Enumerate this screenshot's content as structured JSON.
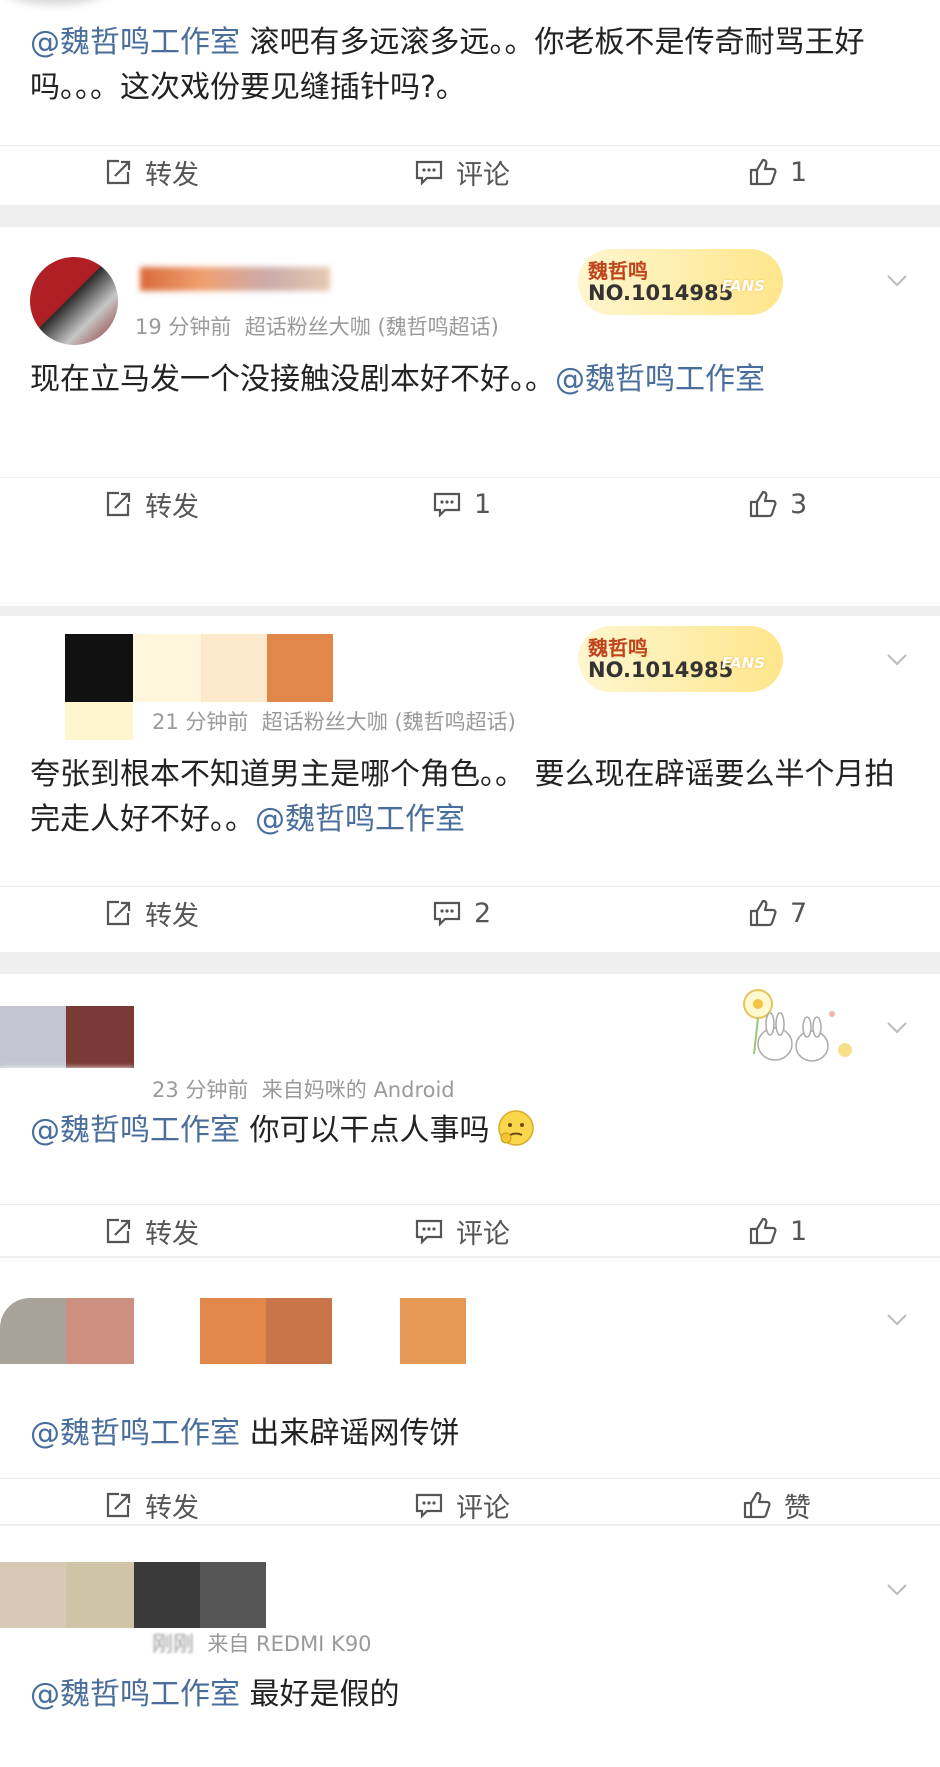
{
  "posts": [
    {
      "mention": "@魏哲鸣工作室",
      "text": " 滚吧有多远滚多远。。你老板不是传奇耐骂王好吗。。。这次戏份要见缝插针吗?。",
      "repost_label": "转发",
      "comment_label": "评论",
      "like_count": "1"
    },
    {
      "time": "19 分钟前",
      "source": "超话粉丝大咖 (魏哲鸣超话)",
      "badge_name": "魏哲鸣",
      "badge_no": "NO.1014985",
      "badge_fans": "FANS",
      "text": "现在立马发一个没接触没剧本好不好。。",
      "mention": "@魏哲鸣工作室",
      "repost_label": "转发",
      "comment_count": "1",
      "like_count": "3"
    },
    {
      "time": "21 分钟前",
      "source": "超话粉丝大咖 (魏哲鸣超话)",
      "badge_name": "魏哲鸣",
      "badge_no": "NO.1014985",
      "badge_fans": "FANS",
      "text": "夸张到根本不知道男主是哪个角色。。 要么现在辟谣要么半个月拍完走人好不好。。",
      "mention": "@魏哲鸣工作室",
      "repost_label": "转发",
      "comment_count": "2",
      "like_count": "7"
    },
    {
      "time": "23 分钟前",
      "source": "来自妈咪的 Android",
      "mention": "@魏哲鸣工作室",
      "text": " 你可以干点人事吗",
      "repost_label": "转发",
      "comment_label": "评论",
      "like_count": "1"
    },
    {
      "mention": "@魏哲鸣工作室",
      "text": " 出来辟谣网传饼",
      "repost_label": "转发",
      "comment_label": "评论",
      "like_label": "赞"
    },
    {
      "time": "刚刚",
      "source": "来自 REDMI K90",
      "mention": "@魏哲鸣工作室",
      "text": " 最好是假的"
    }
  ],
  "colors": {
    "mention": "#4a6e9c",
    "badge_gold": "#ffe68c",
    "separator": "#efefef"
  }
}
